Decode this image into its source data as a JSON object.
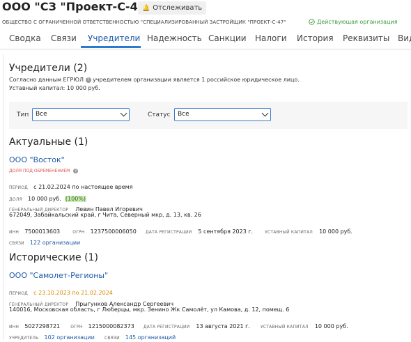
{
  "header": {
    "title": "ООО \"СЗ \"Проект-С-47\"",
    "track_label": "Отслеживать",
    "full_name": "ОБЩЕСТВО С ОГРАНИЧЕННОЙ ОТВЕТСТВЕННОСТЬЮ \"СПЕЦИАЛИЗИРОВАННЫЙ ЗАСТРОЙЩИК \"ПРОЕКТ-С-47\"",
    "status": "Действующая организация",
    "status_color": "#3a9a3a"
  },
  "tabs": [
    "Сводка",
    "Связи",
    "Учредители",
    "Надежность",
    "Санкции",
    "Налоги",
    "История",
    "Реквизиты",
    "Вид"
  ],
  "active_tab": "Учредители",
  "founders": {
    "heading": "Учредители (2)",
    "desc_before": "Согласно данным ЕГРЮЛ",
    "desc_after": "учредителем организации является 1 российское юридическое лицо.",
    "capital": "Уставный капитал: 10 000 руб."
  },
  "filters": {
    "type_label": "Тип",
    "type_value": "Все",
    "status_label": "Статус",
    "status_value": "Все"
  },
  "actual": {
    "heading": "Актуальные (1)",
    "name": "ООО \"Восток\"",
    "encumbrance": "ДОЛЯ ПОД ОБРЕМЕНЕНИЕМ",
    "period_label": "ПЕРИОД",
    "period": "с 21.02.2024 по настоящее время",
    "share_label": "ДОЛЯ",
    "share_amount": "10 000 руб.",
    "share_percent": "(100%)",
    "director_label": "ГЕНЕРАЛЬНЫЙ ДИРЕКТОР",
    "director": "Левин Павел Игоревич",
    "address": "672049, Забайкальский край, г Чита, Северный мкр, д. 13, кв. 26",
    "inn_label": "ИНН",
    "inn": "7500013603",
    "ogrn_label": "ОГРН",
    "ogrn": "1237500006050",
    "reg_label": "ДАТА РЕГИСТРАЦИИ",
    "reg_date": "5 сентября 2023 г.",
    "cap_label": "УСТАВНЫЙ КАПИТАЛ",
    "cap": "10 000 руб.",
    "links_label": "СВЯЗИ",
    "links": "122 организации"
  },
  "historical": {
    "heading": "Исторические (1)",
    "name": "ООО \"Самолет-Регионы\"",
    "period_label": "ПЕРИОД",
    "period": "с 23.10.2023 по 21.02.2024",
    "director_label": "ГЕНЕРАЛЬНЫЙ ДИРЕКТОР",
    "director": "Прыгунков Александр Сергеевич",
    "address": "140016, Московская область, г Люберцы, мкр. Зенино Жк Самолёт, ул Камова, д. 12, помещ. 6",
    "inn_label": "ИНН",
    "inn": "5027298721",
    "ogrn_label": "ОГРН",
    "ogrn": "1215000082373",
    "reg_label": "ДАТА РЕГИСТРАЦИИ",
    "reg_date": "13 августа 2021 г.",
    "cap_label": "УСТАВНЫЙ КАПИТАЛ",
    "cap": "10 000 руб.",
    "founder_label": "УЧРЕДИТЕЛЬ",
    "founder_links": "102 организации",
    "links_label": "СВЯЗИ",
    "links": "145 организаций"
  },
  "colors": {
    "accent": "#1e5aa8",
    "encumbrance": "#d9534f",
    "historical_period": "#d98a00"
  }
}
